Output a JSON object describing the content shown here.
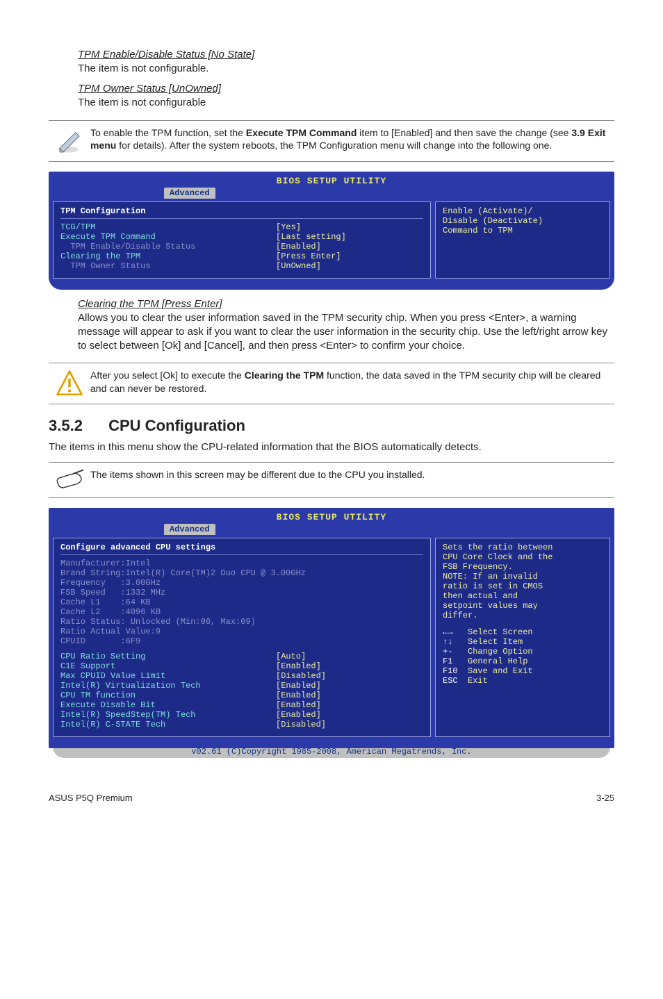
{
  "section_tpm_enable": {
    "heading": "TPM Enable/Disable Status [No State]",
    "text": "The item is not configurable."
  },
  "section_tpm_owner": {
    "heading": "TPM Owner Status [UnOwned]",
    "text": "The item is not configurable"
  },
  "note_enable_tpm": {
    "part1": "To enable the TPM function, set the ",
    "bold1": "Execute TPM Command",
    "part2": " item to [Enabled] and then save the change (see ",
    "bold2": "3.9 Exit menu",
    "part3": " for details). After the system reboots, the TPM Configuration menu will change into the following one."
  },
  "bios1": {
    "title": "BIOS SETUP UTILITY",
    "tab": "Advanced",
    "header": "TPM Configuration",
    "rows": [
      {
        "label": "TCG/TPM",
        "value": "[Yes]",
        "label_cls": "cyan",
        "value_cls": "yellow"
      },
      {
        "label": "Execute TPM Command",
        "value": "[Last setting]",
        "label_cls": "cyan",
        "value_cls": "yellow"
      },
      {
        "label": "  TPM Enable/Disable Status",
        "value": "[Enabled]",
        "label_cls": "muted",
        "value_cls": "muted"
      },
      {
        "label": "Clearing the TPM",
        "value": "[Press Enter]",
        "label_cls": "cyan",
        "value_cls": "yellow"
      },
      {
        "label": "  TPM Owner Status",
        "value": "[UnOwned]",
        "label_cls": "muted",
        "value_cls": "muted"
      }
    ],
    "right_help": "Enable (Activate)/\nDisable (Deactivate)\nCommand to TPM"
  },
  "section_clearing": {
    "heading": "Clearing the TPM [Press Enter]",
    "text": "Allows you to clear the user information saved in the TPM security chip. When you press <Enter>, a warning message will appear to ask if you want to clear the user information in the security chip. Use the left/right arrow key to select between [Ok] and [Cancel], and then press <Enter> to confirm your choice."
  },
  "note_clearing": {
    "part1": "After you select [Ok] to execute the ",
    "bold1": "Clearing the TPM",
    "part2": " function, the data saved in the TPM security chip will be cleared and can never be restored."
  },
  "cpu_conf": {
    "number": "3.5.2",
    "title": "CPU Configuration",
    "intro": "The items in this menu show the CPU-related information that the BIOS automatically detects."
  },
  "note_cpu": "The items shown in this screen may be different due to the CPU you installed.",
  "bios2": {
    "title": "BIOS SETUP UTILITY",
    "tab": "Advanced",
    "header": "Configure advanced CPU settings",
    "info_lines": [
      "Manufacturer:Intel",
      "Brand String:Intel(R) Core(TM)2 Duo CPU @ 3.00GHz",
      "Frequency   :3.00GHz",
      "FSB Speed   :1332 MHz",
      "Cache L1    :64 KB",
      "Cache L2    :4096 KB",
      "Ratio Status: Unlocked (Min:06, Max:09)",
      "Ratio Actual Value:9",
      "CPUID       :6F9"
    ],
    "settings": [
      {
        "label": "CPU Ratio Setting",
        "value": "[Auto]"
      },
      {
        "label": "C1E Support",
        "value": "[Enabled]"
      },
      {
        "label": "Max CPUID Value Limit",
        "value": "[Disabled]"
      },
      {
        "label": "Intel(R) Virtualization Tech",
        "value": "[Enabled]"
      },
      {
        "label": "CPU TM function",
        "value": "[Enabled]"
      },
      {
        "label": "Execute Disable Bit",
        "value": "[Enabled]"
      },
      {
        "label": "Intel(R) SpeedStep(TM) Tech",
        "value": "[Enabled]"
      },
      {
        "label": "Intel(R) C-STATE Tech",
        "value": "[Disabled]"
      }
    ],
    "right_help": "Sets the ratio between\nCPU Core Clock and the\nFSB Frequency.\nNOTE: If an invalid\nratio is set in CMOS\nthen actual and\nsetpoint values may\ndiffer.",
    "keys": [
      {
        "k": "←→",
        "t": "Select Screen"
      },
      {
        "k": "↑↓",
        "t": "Select Item"
      },
      {
        "k": "+-",
        "t": "Change Option"
      },
      {
        "k": "F1",
        "t": "General Help"
      },
      {
        "k": "F10",
        "t": "Save and Exit"
      },
      {
        "k": "ESC",
        "t": "Exit"
      }
    ],
    "footer": "v02.61 (C)Copyright 1985-2008, American Megatrends, Inc."
  },
  "page_footer_left": "ASUS P5Q Premium",
  "page_footer_right": "3-25"
}
